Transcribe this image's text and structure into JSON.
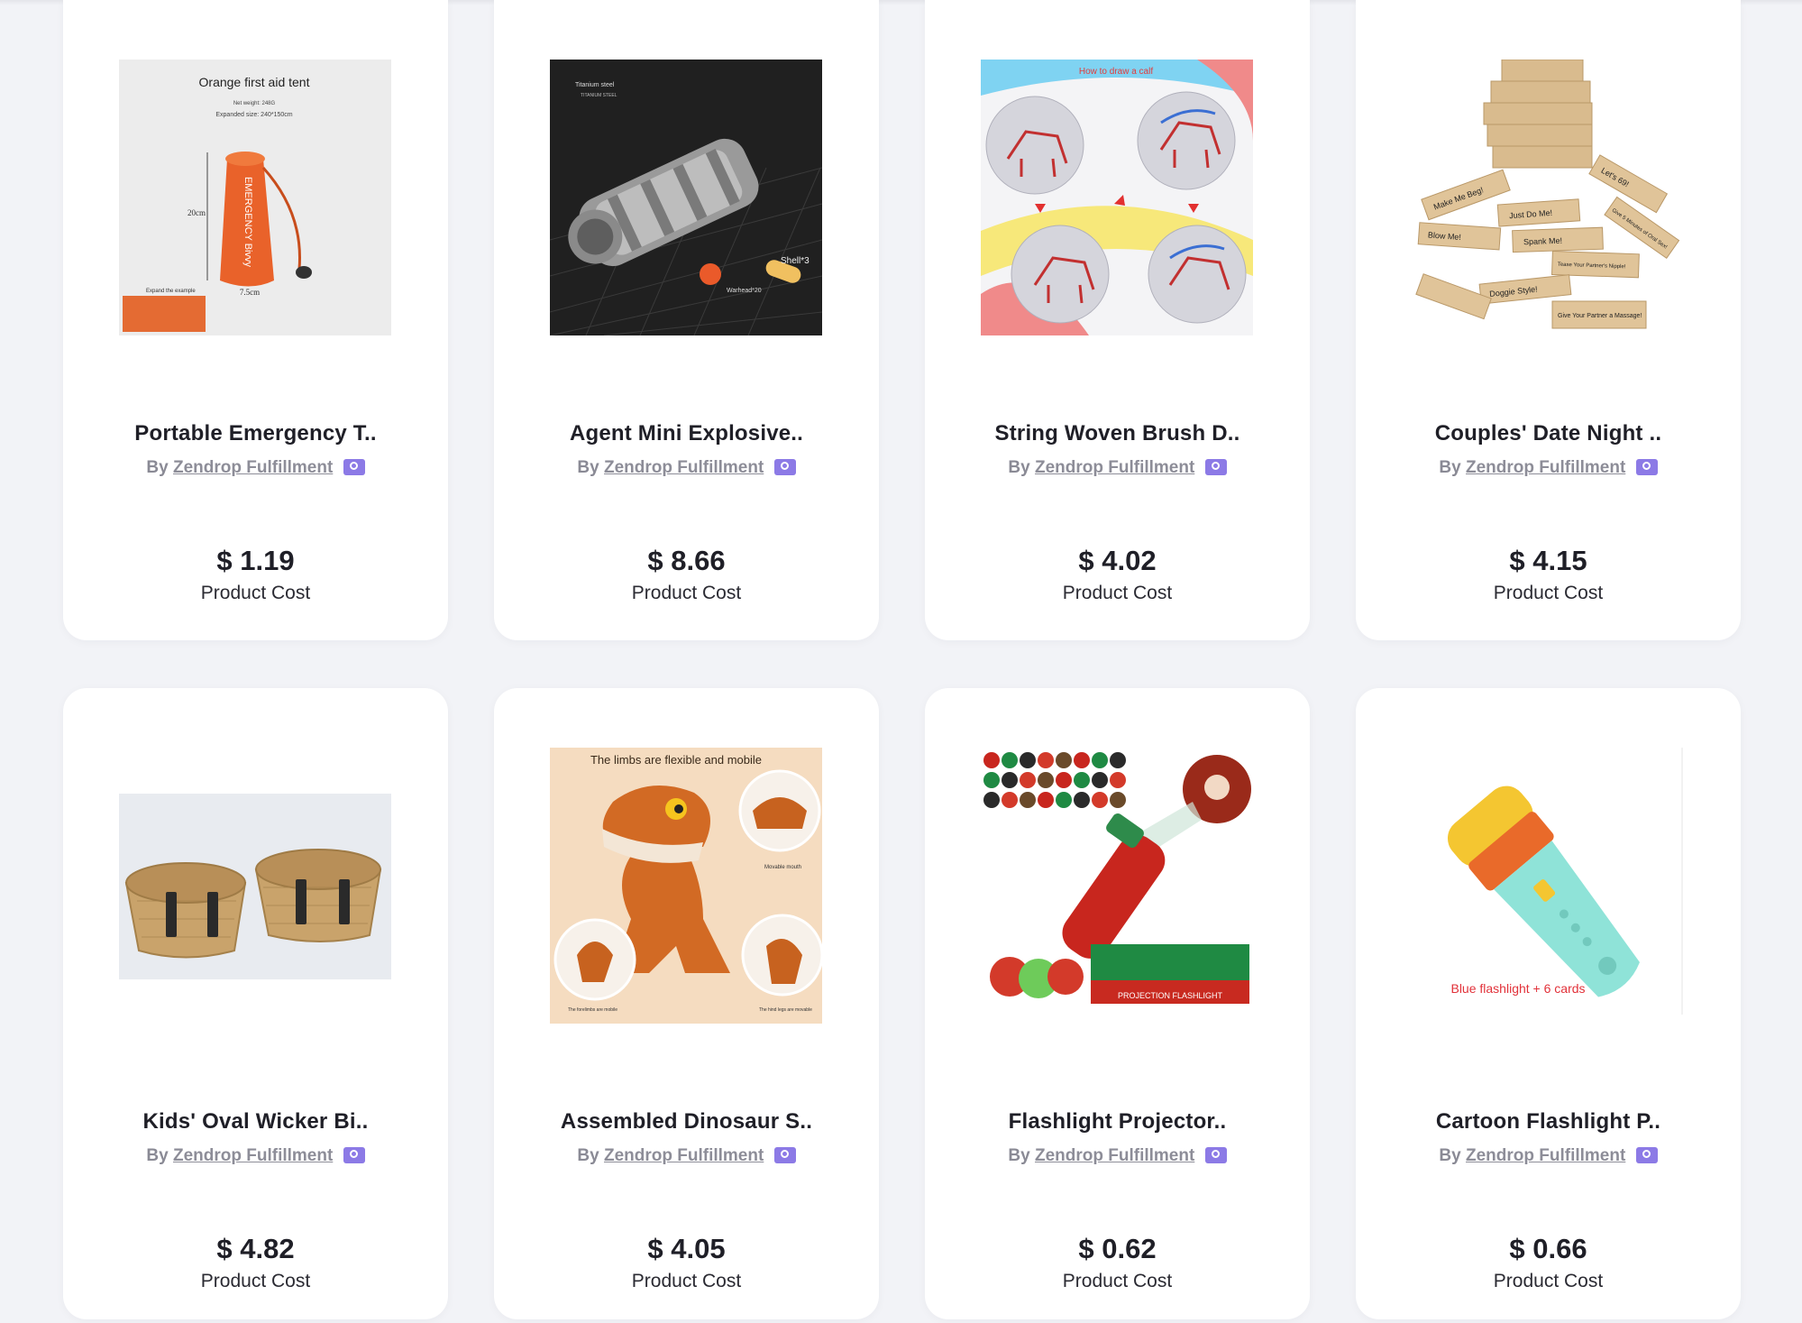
{
  "products": [
    {
      "title": "Portable Emergency T..",
      "by_prefix": "By",
      "vendor": "Zendrop Fulfillment",
      "price": "$ 1.19",
      "price_label": "Product Cost",
      "image_text": {
        "heading": "Orange first aid tent",
        "line1": "Net weight: 248G",
        "line2": "Expanded size: 240*150cm",
        "bag": "EMERGENCY Bivvy",
        "h": "20cm",
        "w": "7.5cm",
        "note": "Expand the example"
      }
    },
    {
      "title": "Agent Mini Explosive..",
      "by_prefix": "By",
      "vendor": "Zendrop Fulfillment",
      "price": "$ 8.66",
      "price_label": "Product Cost",
      "image_text": {
        "tag1": "Titanium steel",
        "tag2": "TITANIUM STEEL",
        "shell": "Shell*3",
        "warhead": "Warhead*20"
      }
    },
    {
      "title": "String Woven Brush D..",
      "by_prefix": "By",
      "vendor": "Zendrop Fulfillment",
      "price": "$ 4.02",
      "price_label": "Product Cost",
      "image_text": {
        "heading": "How to draw a calf"
      }
    },
    {
      "title": "Couples' Date Night ..",
      "by_prefix": "By",
      "vendor": "Zendrop Fulfillment",
      "price": "$ 4.15",
      "price_label": "Product Cost",
      "image_text": {
        "b1": "Make Me Beg!",
        "b2": "Just Do Me!",
        "b3": "Let's 69!",
        "b4": "Blow Me!",
        "b5": "Spank Me!",
        "b6": "Give 5 Minutes of Oral Sex!",
        "b7": "Tease Your Partner's Nipple!",
        "b8": "Doggie Style!",
        "b9": "Give Your Partner a Massage!"
      }
    },
    {
      "title": "Kids' Oval Wicker Bi..",
      "by_prefix": "By",
      "vendor": "Zendrop Fulfillment",
      "price": "$ 4.82",
      "price_label": "Product Cost",
      "image_text": {}
    },
    {
      "title": "Assembled Dinosaur S..",
      "by_prefix": "By",
      "vendor": "Zendrop Fulfillment",
      "price": "$ 4.05",
      "price_label": "Product Cost",
      "image_text": {
        "heading": "The limbs are flexible and mobile",
        "mouth": "Movable mouth",
        "fore": "The forelimbs are mobile",
        "hind": "The hind legs are movable"
      }
    },
    {
      "title": "Flashlight Projector..",
      "by_prefix": "By",
      "vendor": "Zendrop Fulfillment",
      "price": "$ 0.62",
      "price_label": "Product Cost",
      "image_text": {
        "box": "PROJECTION FLASHLIGHT"
      }
    },
    {
      "title": "Cartoon Flashlight P..",
      "by_prefix": "By",
      "vendor": "Zendrop Fulfillment",
      "price": "$ 0.66",
      "price_label": "Product Cost",
      "image_text": {
        "caption": "Blue flashlight + 6 cards"
      }
    }
  ],
  "colors": {
    "page_bg": "#f2f3f7",
    "card_bg": "#ffffff",
    "badge": "#8c7ae6",
    "title": "#1f1f27",
    "muted": "#8a8a95"
  }
}
